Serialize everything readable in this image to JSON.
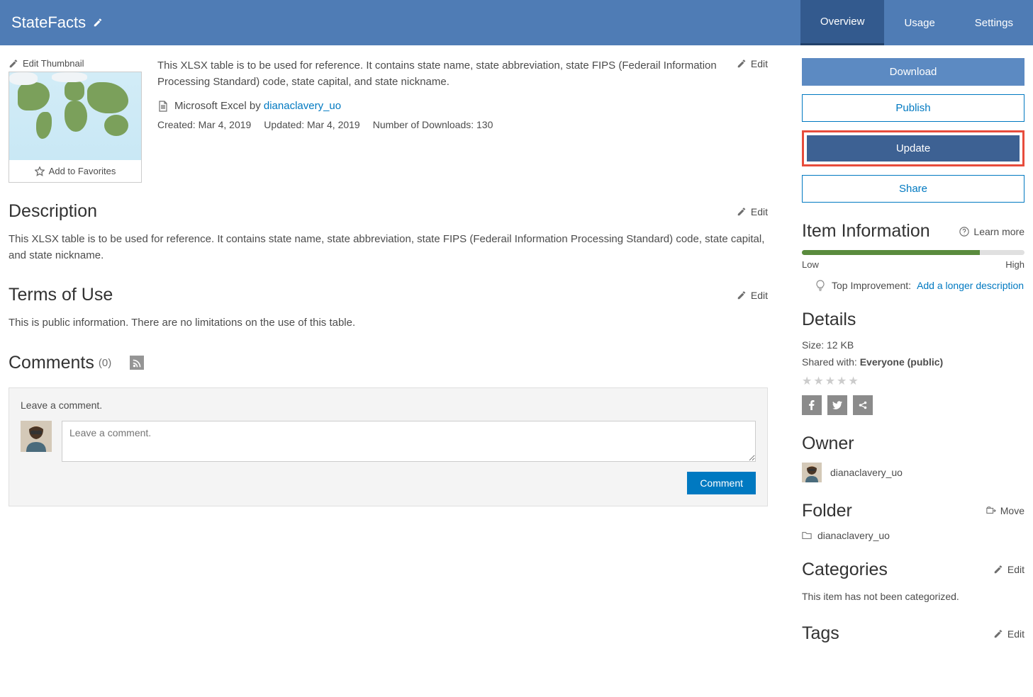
{
  "header": {
    "title": "StateFacts",
    "tabs": [
      {
        "label": "Overview",
        "active": true
      },
      {
        "label": "Usage",
        "active": false
      },
      {
        "label": "Settings",
        "active": false
      }
    ]
  },
  "thumb": {
    "edit_label": "Edit Thumbnail",
    "favorites_label": "Add to Favorites"
  },
  "summary": {
    "text": "This XLSX table is to be used for reference. It contains state name, state abbreviation, state FIPS (Federail Information Processing Standard) code, state capital, and state nickname.",
    "file_type": "Microsoft Excel by",
    "author": "dianaclavery_uo",
    "created": "Created: Mar 4, 2019",
    "updated": "Updated: Mar 4, 2019",
    "downloads": "Number of Downloads: 130",
    "edit_label": "Edit"
  },
  "description": {
    "title": "Description",
    "body": "This XLSX table is to be used for reference.  It contains state name, state abbreviation, state FIPS (Federail Information Processing Standard) code, state capital, and state nickname.",
    "edit_label": "Edit"
  },
  "terms": {
    "title": "Terms of Use",
    "body": "This is public information.  There are no limitations on the use of this table.",
    "edit_label": "Edit"
  },
  "comments": {
    "title": "Comments",
    "count": "(0)",
    "leave_label": "Leave a comment.",
    "placeholder": "Leave a comment.",
    "submit_label": "Comment"
  },
  "actions": {
    "download": "Download",
    "publish": "Publish",
    "update": "Update",
    "share": "Share"
  },
  "item_info": {
    "title": "Item Information",
    "learn_more": "Learn more",
    "low": "Low",
    "high": "High",
    "top_improvement_label": "Top Improvement:",
    "improvement_link": "Add a longer description"
  },
  "details": {
    "title": "Details",
    "size_label": "Size: ",
    "size_value": "12 KB",
    "shared_label": "Shared with: ",
    "shared_value": "Everyone (public)"
  },
  "owner": {
    "title": "Owner",
    "name": "dianaclavery_uo"
  },
  "folder": {
    "title": "Folder",
    "move_label": "Move",
    "name": "dianaclavery_uo"
  },
  "categories": {
    "title": "Categories",
    "edit_label": "Edit",
    "body": "This item has not been categorized."
  },
  "tags": {
    "title": "Tags",
    "edit_label": "Edit"
  }
}
